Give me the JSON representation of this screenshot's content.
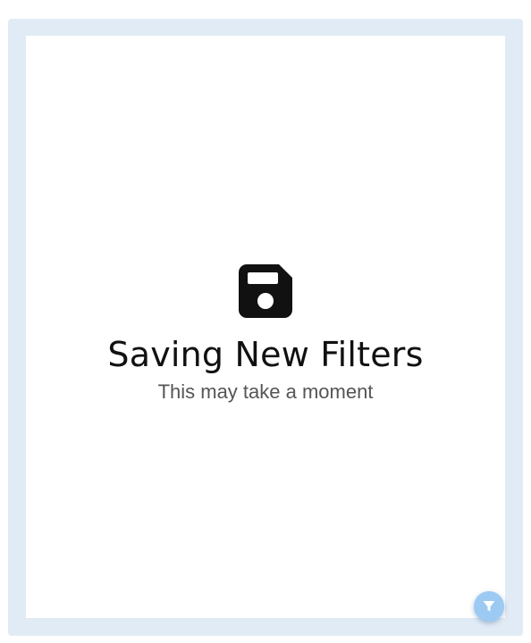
{
  "loading": {
    "icon": "floppy-disk-icon",
    "title": "Saving New Filters",
    "subtitle": "This may take a moment"
  },
  "fab": {
    "icon": "filter-icon"
  },
  "colors": {
    "frame": "#e1ebf6",
    "panel": "#ffffff",
    "icon": "#111111",
    "fab": "#9ccaf3"
  }
}
